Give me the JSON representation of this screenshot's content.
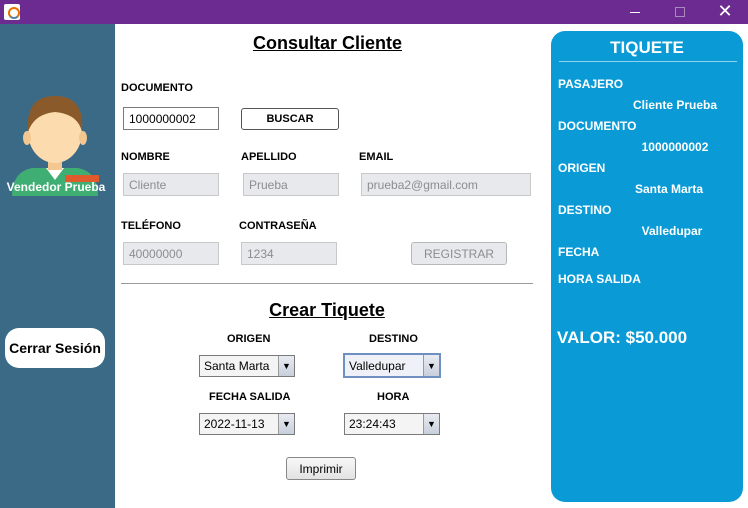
{
  "titlebar": {
    "minimize_icon": "minimize-icon",
    "maximize_icon": "maximize-icon",
    "close_icon": "close-icon",
    "close_glyph": "✕"
  },
  "sidebar": {
    "vendor_name": "Vendedor Prueba",
    "logout_label": "Cerrar Sesión"
  },
  "consultar": {
    "title": "Consultar Cliente",
    "documento_label": "DOCUMENTO",
    "documento_value": "1000000002",
    "buscar_label": "BUSCAR",
    "nombre_label": "NOMBRE",
    "nombre_value": "Cliente",
    "apellido_label": "APELLIDO",
    "apellido_value": "Prueba",
    "email_label": "EMAIL",
    "email_value": "prueba2@gmail.com",
    "telefono_label": "TELÉFONO",
    "telefono_value": "40000000",
    "contrasena_label": "CONTRASEÑA",
    "contrasena_value": "1234",
    "registrar_label": "REGISTRAR"
  },
  "crear": {
    "title": "Crear Tiquete",
    "origen_label": "ORIGEN",
    "origen_value": "Santa Marta",
    "destino_label": "DESTINO",
    "destino_value": "Valledupar",
    "fecha_label": "FECHA SALIDA",
    "fecha_value": "2022-11-13",
    "hora_label": "HORA",
    "hora_value": "23:24:43",
    "imprimir_label": "Imprimir",
    "arrow_glyph": "▼"
  },
  "ticket": {
    "title": "TIQUETE",
    "pasajero_label": "PASAJERO",
    "pasajero_value": "Cliente Prueba",
    "documento_label": "DOCUMENTO",
    "documento_value": "1000000002",
    "origen_label": "ORIGEN",
    "origen_value": "Santa Marta",
    "destino_label": "DESTINO",
    "destino_value": "Valledupar",
    "fecha_label": "FECHA",
    "hora_label": "HORA SALIDA",
    "valor": "VALOR: $50.000"
  },
  "colors": {
    "titlebar": "#6c2b91",
    "sidebar": "#3b6a86",
    "ticket_panel": "#0a9bd6"
  }
}
